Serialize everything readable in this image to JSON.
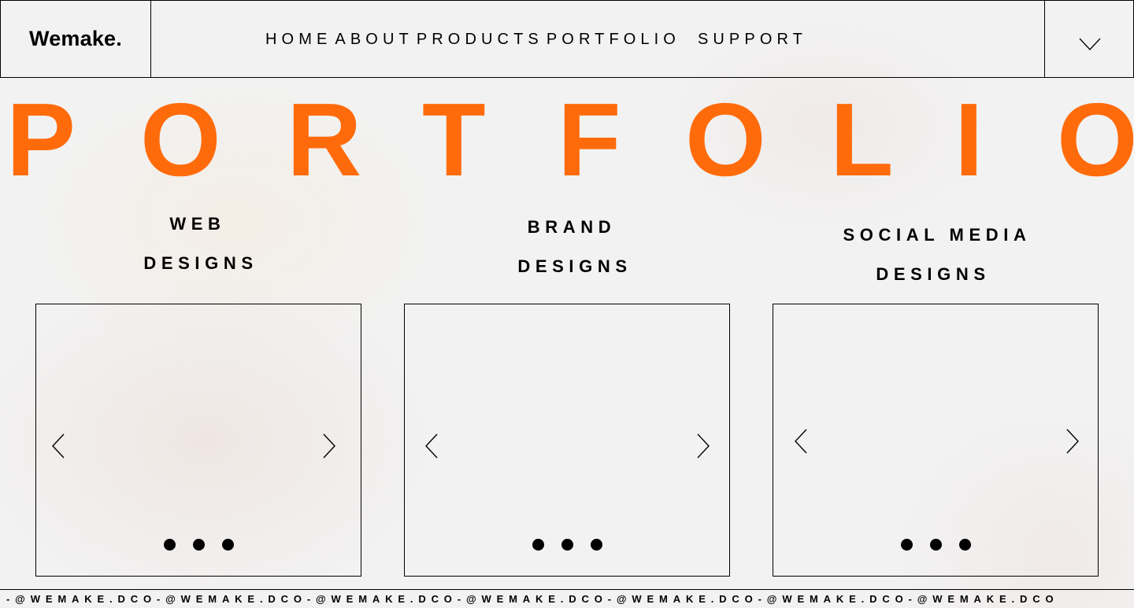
{
  "header": {
    "logo": "Wemake.",
    "nav": [
      "HOME",
      "ABOUT",
      "PRODUCTS",
      "PORTFOLIO",
      "SUPPORT"
    ],
    "menu_icon": "chevron-down-icon"
  },
  "hero": {
    "title": "PORTFOLIO",
    "letters": [
      "P",
      "O",
      "R",
      "T",
      "F",
      "O",
      "L",
      "I",
      "O"
    ],
    "color": "#ff6b0b"
  },
  "categories": [
    {
      "line1": "WEB",
      "line2": "DESIGNS"
    },
    {
      "line1": "BRAND",
      "line2": "DESIGNS"
    },
    {
      "line1": "SOCIAL MEDIA",
      "line2": "DESIGNS"
    }
  ],
  "carousel": {
    "prev_icon": "chevron-left-icon",
    "next_icon": "chevron-right-icon",
    "dot_count": 3
  },
  "footer": {
    "marquee": "-@WEMAKE.DCO-@WEMAKE.DCO-@WEMAKE.DCO-@WEMAKE.DCO-@WEMAKE.DCO-@WEMAKE.DCO-@WEMAKE.DCO"
  }
}
